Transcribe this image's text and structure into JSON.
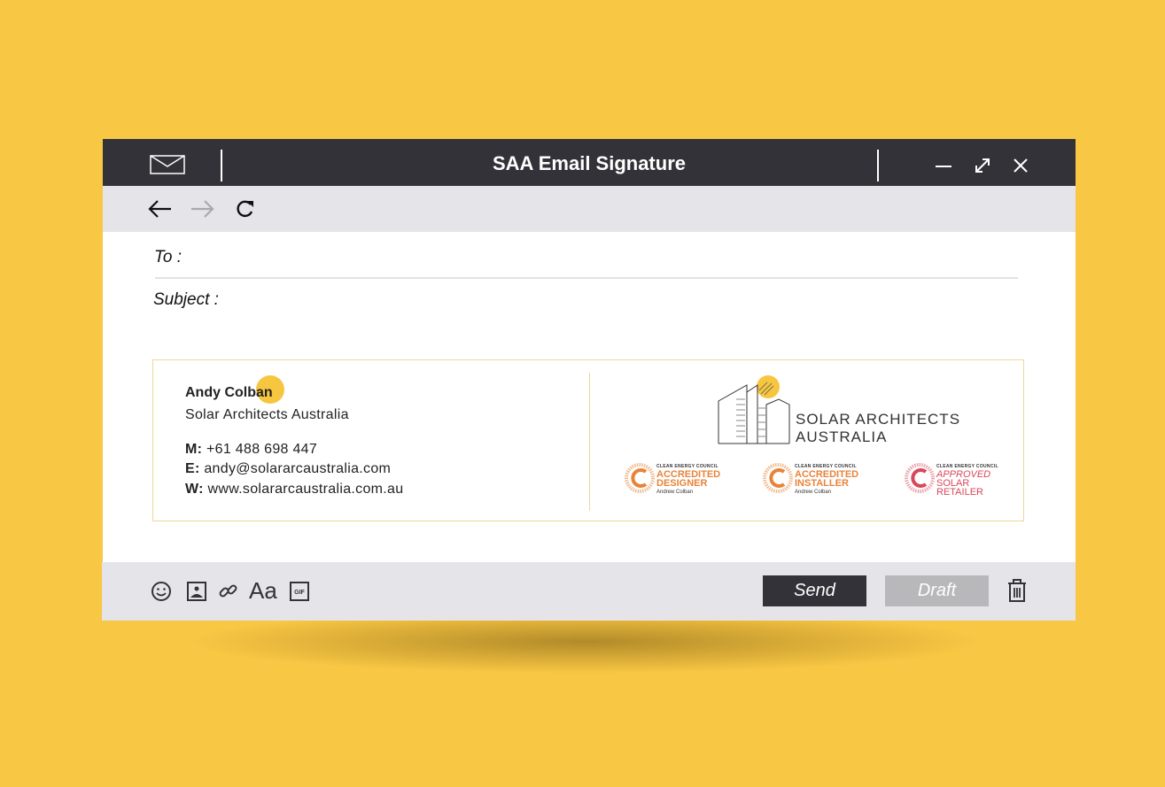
{
  "window": {
    "title": "SAA Email Signature"
  },
  "compose": {
    "to_label": "To :",
    "subject_label": "Subject :"
  },
  "signature": {
    "name": "Andy Colban",
    "company": "Solar Architects Australia",
    "mobile_label": "M:",
    "mobile": "+61 488 698 447",
    "email_label": "E:",
    "email": "andy@solararcaustralia.com",
    "web_label": "W:",
    "web": "www.solararcaustralia.com.au",
    "logo_line1": "SOLAR ARCHITECTS",
    "logo_line2": "AUSTRALIA",
    "badges": [
      {
        "org": "CLEAN ENERGY COUNCIL",
        "line1": "ACCREDITED",
        "line2": "DESIGNER",
        "person": "Andrew Colban"
      },
      {
        "org": "CLEAN ENERGY COUNCIL",
        "line1": "ACCREDITED",
        "line2": "INSTALLER",
        "person": "Andrew Colban"
      },
      {
        "org": "CLEAN ENERGY COUNCIL",
        "line1": "APPROVED",
        "line2": "SOLAR",
        "line3": "RETAILER"
      }
    ]
  },
  "toolbar": {
    "send_label": "Send",
    "draft_label": "Draft",
    "font_label": "Aa",
    "gif_label": "GIF"
  },
  "colors": {
    "accent": "#F7C640",
    "titlebar": "#333238",
    "badge_orange": "#E8833A",
    "badge_red": "#D9475A"
  }
}
